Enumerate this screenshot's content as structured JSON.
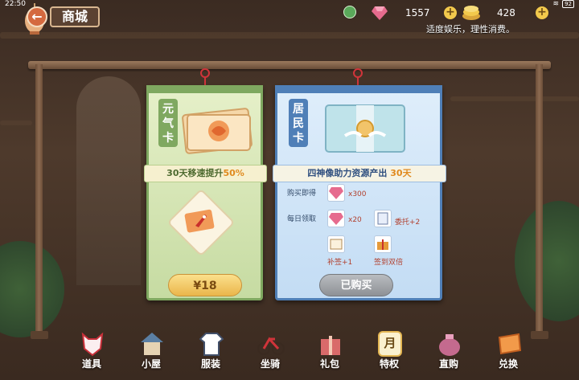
{
  "status_bar": {
    "time": "22:50",
    "battery": "92"
  },
  "header": {
    "back_label": "←",
    "title": "商城"
  },
  "currency": {
    "gem_count": "1557",
    "coin_count": "428",
    "plus_label": "+",
    "notice": "适度娱乐，理性消费。"
  },
  "cards": {
    "vitality": {
      "title_chars": [
        "元",
        "气",
        "卡"
      ],
      "banner_prefix": "30天移速提升",
      "banner_highlight": "50%",
      "price": "¥18",
      "colors": {
        "frame": "#7fa860",
        "price_button": "#eab64b"
      }
    },
    "resident": {
      "title_chars": [
        "居",
        "民",
        "卡"
      ],
      "banner_prefix": "四神像助力资源产出 ",
      "banner_highlight": "30天",
      "buy_label": "购买即得",
      "buy_qty": "x300",
      "daily_label": "每日领取",
      "daily_qty": "x20",
      "daily_commission": "委托+2",
      "daily_makeup": "补签+1",
      "daily_double": "签到双倍",
      "button": "已购买",
      "colors": {
        "frame": "#4f7fb7",
        "button": "#8e9196"
      }
    }
  },
  "nav": {
    "items": [
      {
        "label": "道具",
        "icon": "fox-mask-icon"
      },
      {
        "label": "小屋",
        "icon": "house-icon"
      },
      {
        "label": "服装",
        "icon": "shirt-icon"
      },
      {
        "label": "坐骑",
        "icon": "bicycle-icon"
      },
      {
        "label": "礼包",
        "icon": "gift-icon"
      },
      {
        "label": "特权",
        "icon": "calendar-icon",
        "calendar_char": "月"
      },
      {
        "label": "直购",
        "icon": "money-bag-icon"
      },
      {
        "label": "兑换",
        "icon": "ticket-icon"
      }
    ]
  }
}
